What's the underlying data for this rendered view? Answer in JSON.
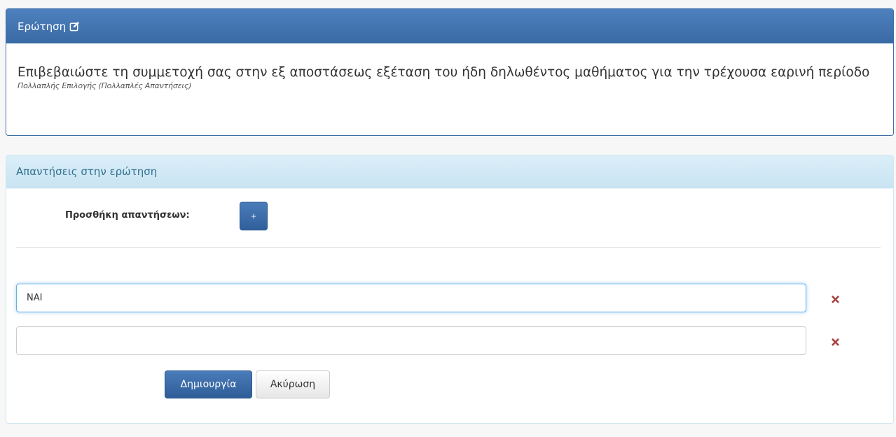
{
  "question_panel": {
    "heading": "Ερώτηση",
    "edit_icon": "edit-icon",
    "question_text": "Επιβεβαιώστε τη συμμετοχή σας στην εξ αποστάσεως εξέταση του ήδη δηλωθέντος μαθήματος για την τρέχουσα εαρινή περίοδο",
    "question_type": "Πολλαπλής Επιλογής (Πολλαπλές Απαντήσεις)"
  },
  "answers_panel": {
    "heading": "Απαντήσεις στην ερώτηση",
    "add_label": "Προσθήκη απαντήσεων:",
    "add_button_label": "+",
    "answers": [
      {
        "value": "ΝΑΙ",
        "remove_icon": "remove-icon"
      },
      {
        "value": "",
        "remove_icon": "remove-icon"
      }
    ],
    "create_label": "Δημιουργία",
    "cancel_label": "Ακύρωση"
  },
  "colors": {
    "primary": "#3a6aa5",
    "info_heading_bg": "#d9edf7",
    "info_heading_text": "#31708f",
    "remove_icon": "#a94442",
    "focus_border": "#66afe9"
  }
}
